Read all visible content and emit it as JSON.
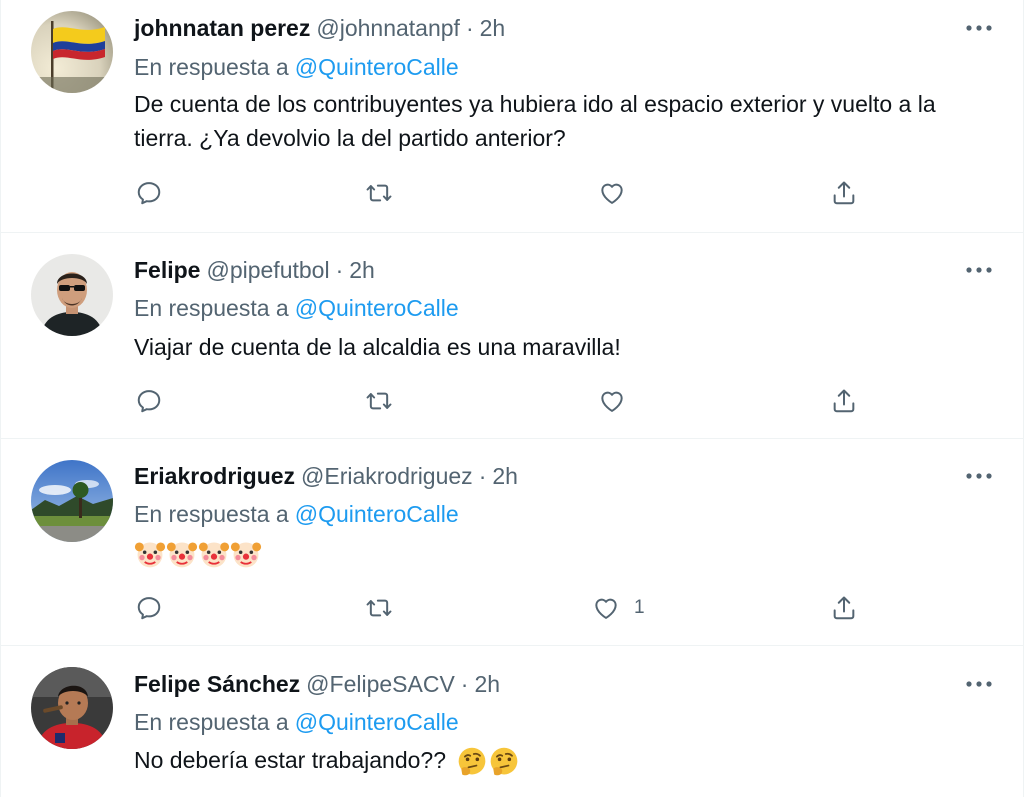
{
  "colors": {
    "text": "#0f1419",
    "secondary": "#536471",
    "accent": "#1d9bf0",
    "divider": "#eff3f4"
  },
  "tweets": [
    {
      "name": "johnnatan perez",
      "handle": "@johnnatanpf",
      "dot": "·",
      "time": "2h",
      "reply_prefix": "En respuesta a",
      "reply_to": "@QuinteroCalle",
      "text": "De cuenta de los contribuyentes ya hubiera ido al espacio exterior y vuelto a la tierra. ¿Ya devolvio la del partido anterior?",
      "avatar_icon": "colombia-flag-avatar",
      "likes": ""
    },
    {
      "name": "Felipe",
      "handle": "@pipefutbol",
      "dot": "·",
      "time": "2h",
      "reply_prefix": "En respuesta a",
      "reply_to": "@QuinteroCalle",
      "text": "Viajar de cuenta de la alcaldia es una maravilla!",
      "avatar_icon": "man-sunglasses-avatar",
      "likes": ""
    },
    {
      "name": "Eriakrodriguez",
      "handle": "@Eriakrodriguez",
      "dot": "·",
      "time": "2h",
      "reply_prefix": "En respuesta a",
      "reply_to": "@QuinteroCalle",
      "text": "",
      "emojis": [
        "clown-face-emoji",
        "clown-face-emoji",
        "clown-face-emoji",
        "clown-face-emoji"
      ],
      "avatar_icon": "landscape-avatar",
      "likes": "1"
    },
    {
      "name": "Felipe Sánchez",
      "handle": "@FelipeSACV",
      "dot": "·",
      "time": "2h",
      "reply_prefix": "En respuesta a",
      "reply_to": "@QuinteroCalle",
      "text": "No debería estar trabajando??",
      "emojis": [
        "thinking-face-emoji",
        "thinking-face-emoji"
      ],
      "avatar_icon": "man-red-shirt-avatar",
      "likes": ""
    }
  ]
}
